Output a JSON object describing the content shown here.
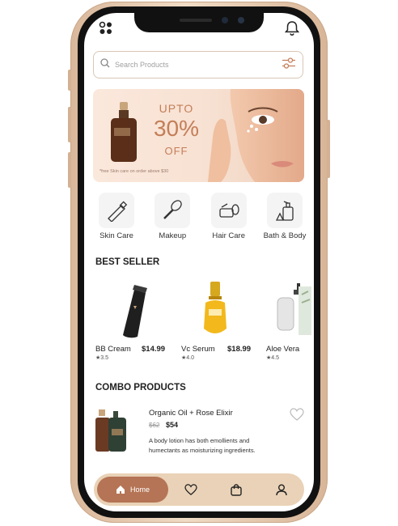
{
  "search": {
    "placeholder": "Search Products"
  },
  "banner": {
    "upto": "UPTO",
    "percent": "30%",
    "off": "OFF",
    "note": "*free Skin care on order above $30"
  },
  "categories": [
    {
      "label": "Skin Care",
      "icon": "tube-icon"
    },
    {
      "label": "Makeup",
      "icon": "brush-icon"
    },
    {
      "label": "Hair Care",
      "icon": "hair-product-icon"
    },
    {
      "label": "Bath & Body",
      "icon": "soap-bottle-icon"
    }
  ],
  "best_seller": {
    "title": "BEST SELLER",
    "products": [
      {
        "name": "BB Cream",
        "price": "$14.99",
        "rating": "3.5"
      },
      {
        "name": "Vc Serum",
        "price": "$18.99",
        "rating": "4.0"
      },
      {
        "name": "Aloe Vera",
        "price": "",
        "rating": "4.5"
      }
    ]
  },
  "combo": {
    "title": "COMBO PRODUCTS",
    "item": {
      "name": "Organic Oil + Rose Elixir",
      "old_price": "$62",
      "price": "$54",
      "description": "A body lotion has both emollients and humectants as moisturizing ingredients."
    }
  },
  "nav": {
    "home_label": "Home"
  },
  "colors": {
    "accent": "#b57455",
    "nav_bg": "#e9d2b7",
    "banner_text": "#c47e58"
  }
}
